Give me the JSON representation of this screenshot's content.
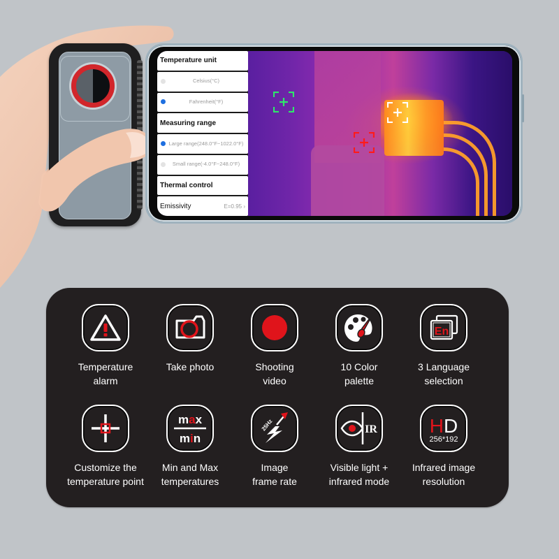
{
  "colors": {
    "background": "#c0c4c8",
    "panel": "#231f20",
    "accent_red": "#e0141b",
    "radio_selected": "#1e6fe0"
  },
  "phone_app": {
    "settings": {
      "temperature_unit": {
        "title": "Temperature unit",
        "options": [
          {
            "label": "Celsius(°C)",
            "selected": false
          },
          {
            "label": "Fahrenheit(°F)",
            "selected": true
          }
        ]
      },
      "measuring_range": {
        "title": "Measuring range",
        "options": [
          {
            "label": "Large range(248.0°F~1022.0°F)",
            "selected": true
          },
          {
            "label": "Small range(-4.0°F~248.0°F)",
            "selected": false
          }
        ]
      },
      "thermal_control": {
        "title": "Thermal control",
        "emissivity_label": "Emissivity",
        "emissivity_value": "E=0.95",
        "chevron": "›"
      }
    },
    "thermal_view": {
      "markers": [
        {
          "type": "reference-point",
          "color": "#2ee86a"
        },
        {
          "type": "max-temp-point",
          "color": "#ffffff"
        },
        {
          "type": "min-temp-point",
          "color": "#ff1a1a"
        }
      ]
    }
  },
  "features": [
    {
      "icon": "warning-icon",
      "line1": "Temperature",
      "line2": "alarm"
    },
    {
      "icon": "camera-icon",
      "line1": "Take photo",
      "line2": ""
    },
    {
      "icon": "record-icon",
      "line1": "Shooting",
      "line2": "video"
    },
    {
      "icon": "palette-icon",
      "line1": "10 Color",
      "line2": "palette"
    },
    {
      "icon": "language-icon",
      "line1": "3 Language",
      "line2": "selection",
      "icon_text": "En"
    },
    {
      "icon": "crosshair-icon",
      "line1": "Customize the",
      "line2": "temperature point"
    },
    {
      "icon": "max-min-icon",
      "line1": "Min and Max",
      "line2": "temperatures",
      "icon_text_top": "max",
      "icon_text_bottom": "min"
    },
    {
      "icon": "frame-rate-icon",
      "line1": "Image",
      "line2": "frame rate",
      "icon_text": "25Hz"
    },
    {
      "icon": "visible-ir-icon",
      "line1": "Visible light +",
      "line2": "infrared mode",
      "icon_text": "IR"
    },
    {
      "icon": "hd-resolution-icon",
      "line1": "Infrared image",
      "line2": "resolution",
      "icon_text_main": "HD",
      "icon_text_sub": "256*192"
    }
  ]
}
